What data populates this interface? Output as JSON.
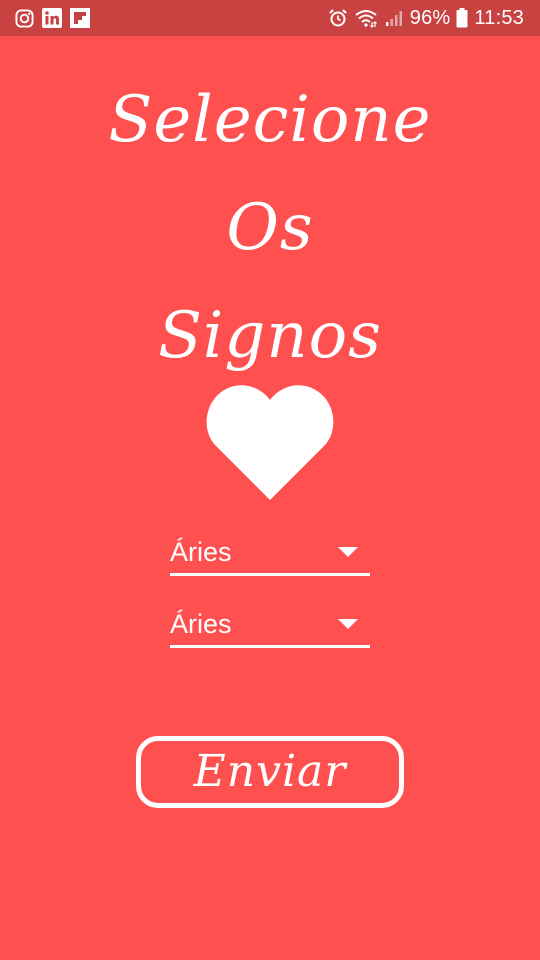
{
  "colors": {
    "background": "#FF5050",
    "status_bar": "#C84242",
    "foreground": "#FFFFFF"
  },
  "status_bar": {
    "notification_icons": [
      "instagram-icon",
      "linkedin-icon",
      "flipboard-icon"
    ],
    "system_icons": [
      "alarm-icon",
      "wifi-icon",
      "signal-icon"
    ],
    "battery_percent": "96%",
    "time": "11:53"
  },
  "title": {
    "line1": "Selecione",
    "line2": "Os",
    "line3": "Signos"
  },
  "heart_icon": "heart-icon",
  "sign_selector_1": {
    "selected": "Áries"
  },
  "sign_selector_2": {
    "selected": "Áries"
  },
  "send_button": {
    "label": "Enviar"
  }
}
